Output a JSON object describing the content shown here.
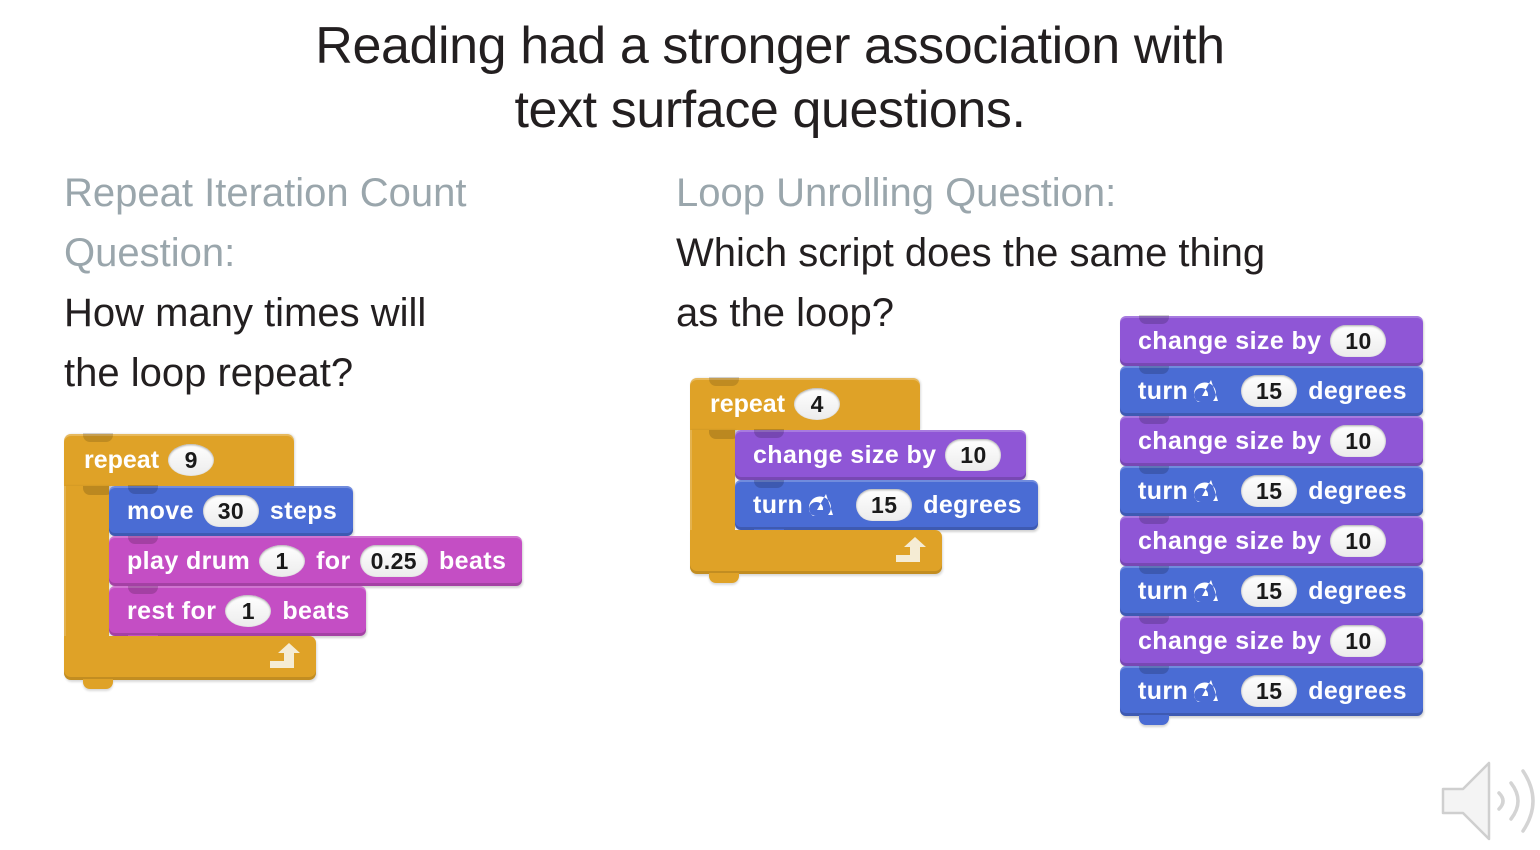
{
  "slide": {
    "title": "Reading had a stronger association with\ntext surface questions.",
    "background_color": "#ffffff",
    "label_color": "#9aa6ac",
    "text_color": "#231f20"
  },
  "left_column": {
    "label": "Repeat Iteration Count\nQuestion:",
    "question": "How many times will\nthe loop repeat?",
    "script": {
      "control_block": {
        "keyword": "repeat",
        "times": "9",
        "color": "#dfa227",
        "loop_arrow_icon": "loop-arrow-icon"
      },
      "body": [
        {
          "category": "motion",
          "color": "#4a6cd4",
          "parts": [
            {
              "type": "text",
              "value": "move"
            },
            {
              "type": "oval",
              "value": "30"
            },
            {
              "type": "text",
              "value": "steps"
            }
          ]
        },
        {
          "category": "sound",
          "color": "#c44ec4",
          "parts": [
            {
              "type": "text",
              "value": "play drum"
            },
            {
              "type": "circle",
              "value": "1"
            },
            {
              "type": "text",
              "value": "for"
            },
            {
              "type": "oval",
              "value": "0.25"
            },
            {
              "type": "text",
              "value": "beats"
            }
          ]
        },
        {
          "category": "sound",
          "color": "#c44ec4",
          "parts": [
            {
              "type": "text",
              "value": "rest for"
            },
            {
              "type": "circle",
              "value": "1"
            },
            {
              "type": "text",
              "value": "beats"
            }
          ]
        }
      ]
    }
  },
  "right_column": {
    "label": "Loop Unrolling Question:",
    "question": "Which script does the same thing\nas the loop?",
    "loop_script": {
      "control_block": {
        "keyword": "repeat",
        "times": "4",
        "color": "#dfa227",
        "loop_arrow_icon": "loop-arrow-icon"
      },
      "body": [
        {
          "category": "looks",
          "color": "#8f56d6",
          "parts": [
            {
              "type": "text",
              "value": "change size by"
            },
            {
              "type": "oval",
              "value": "10"
            }
          ]
        },
        {
          "category": "motion",
          "color": "#4a6cd4",
          "parts": [
            {
              "type": "text",
              "value": "turn"
            },
            {
              "type": "icon",
              "value": "turn-clockwise-icon"
            },
            {
              "type": "oval",
              "value": "15"
            },
            {
              "type": "text",
              "value": "degrees"
            }
          ]
        }
      ]
    },
    "unrolled_script": [
      {
        "category": "looks",
        "color": "#8f56d6",
        "parts": [
          {
            "type": "text",
            "value": "change size by"
          },
          {
            "type": "oval",
            "value": "10"
          }
        ]
      },
      {
        "category": "motion",
        "color": "#4a6cd4",
        "parts": [
          {
            "type": "text",
            "value": "turn"
          },
          {
            "type": "icon",
            "value": "turn-clockwise-icon"
          },
          {
            "type": "oval",
            "value": "15"
          },
          {
            "type": "text",
            "value": "degrees"
          }
        ]
      },
      {
        "category": "looks",
        "color": "#8f56d6",
        "parts": [
          {
            "type": "text",
            "value": "change size by"
          },
          {
            "type": "oval",
            "value": "10"
          }
        ]
      },
      {
        "category": "motion",
        "color": "#4a6cd4",
        "parts": [
          {
            "type": "text",
            "value": "turn"
          },
          {
            "type": "icon",
            "value": "turn-clockwise-icon"
          },
          {
            "type": "oval",
            "value": "15"
          },
          {
            "type": "text",
            "value": "degrees"
          }
        ]
      },
      {
        "category": "looks",
        "color": "#8f56d6",
        "parts": [
          {
            "type": "text",
            "value": "change size by"
          },
          {
            "type": "oval",
            "value": "10"
          }
        ]
      },
      {
        "category": "motion",
        "color": "#4a6cd4",
        "parts": [
          {
            "type": "text",
            "value": "turn"
          },
          {
            "type": "icon",
            "value": "turn-clockwise-icon"
          },
          {
            "type": "oval",
            "value": "15"
          },
          {
            "type": "text",
            "value": "degrees"
          }
        ]
      },
      {
        "category": "looks",
        "color": "#8f56d6",
        "parts": [
          {
            "type": "text",
            "value": "change size by"
          },
          {
            "type": "oval",
            "value": "10"
          }
        ]
      },
      {
        "category": "motion",
        "color": "#4a6cd4",
        "parts": [
          {
            "type": "text",
            "value": "turn"
          },
          {
            "type": "icon",
            "value": "turn-clockwise-icon"
          },
          {
            "type": "oval",
            "value": "15"
          },
          {
            "type": "text",
            "value": "degrees"
          }
        ]
      }
    ]
  },
  "media": {
    "speaker_icon": "speaker-icon",
    "speaker_icon_color": "#f2f2f2"
  }
}
